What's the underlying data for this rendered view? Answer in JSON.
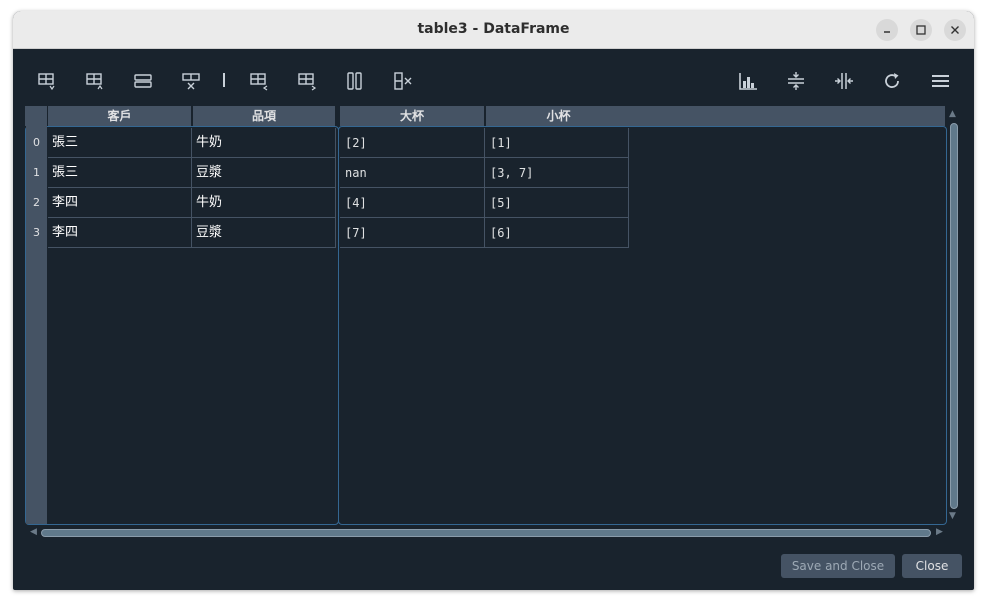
{
  "window": {
    "title": "table3 - DataFrame"
  },
  "toolbar": {
    "left_icons": [
      "insert-row-above-icon",
      "insert-row-below-icon",
      "duplicate-row-icon",
      "remove-row-icon",
      "insert-column-left-icon",
      "insert-column-right-icon",
      "duplicate-column-icon",
      "remove-column-icon"
    ],
    "right_icons": [
      "histogram-icon",
      "resize-rows-icon",
      "resize-columns-icon",
      "refresh-icon",
      "menu-icon"
    ]
  },
  "index_table": {
    "headers": [
      "客戶",
      "品項"
    ],
    "index": [
      "0",
      "1",
      "2",
      "3"
    ],
    "rows": [
      [
        "張三",
        "牛奶"
      ],
      [
        "張三",
        "豆漿"
      ],
      [
        "李四",
        "牛奶"
      ],
      [
        "李四",
        "豆漿"
      ]
    ]
  },
  "data_table": {
    "headers": [
      "大杯",
      "小杯"
    ],
    "rows": [
      [
        "[2]",
        "[1]"
      ],
      [
        "nan",
        "[3, 7]"
      ],
      [
        "[4]",
        "[5]"
      ],
      [
        "[7]",
        "[6]"
      ]
    ]
  },
  "buttons": {
    "save_close": "Save and Close",
    "close": "Close"
  },
  "colors": {
    "background": "#19232d",
    "header": "#455364",
    "accent": "#346792",
    "scroll_thumb": "#60798b"
  }
}
